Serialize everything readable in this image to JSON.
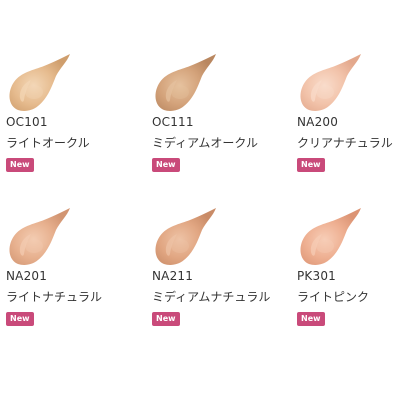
{
  "colors": {
    "badge_bg": "#c94a7a",
    "text": "#333333"
  },
  "badge_label": "New",
  "products": [
    {
      "code": "OC101",
      "name": "ライトオークル",
      "swatch_color": "#e6bb8e",
      "swatch_highlight": "#f3d7b7",
      "swatch_shadow": "#cf9e6d",
      "icon": "foundation-drop-icon"
    },
    {
      "code": "OC111",
      "name": "ミディアムオークル",
      "swatch_color": "#d4a37b",
      "swatch_highlight": "#e6c29f",
      "swatch_shadow": "#b98760",
      "icon": "foundation-drop-icon"
    },
    {
      "code": "NA200",
      "name": "クリアナチュラル",
      "swatch_color": "#f2c3aa",
      "swatch_highlight": "#f9dccb",
      "swatch_shadow": "#e3a88c",
      "icon": "foundation-drop-icon"
    },
    {
      "code": "NA201",
      "name": "ライトナチュラル",
      "swatch_color": "#e7b08e",
      "swatch_highlight": "#f3ccb2",
      "swatch_shadow": "#d29572",
      "icon": "foundation-drop-icon"
    },
    {
      "code": "NA211",
      "name": "ミディアムナチュラル",
      "swatch_color": "#e1a682",
      "swatch_highlight": "#eec3a6",
      "swatch_shadow": "#c98b67",
      "icon": "foundation-drop-icon"
    },
    {
      "code": "PK301",
      "name": "ライトピンク",
      "swatch_color": "#eeaf91",
      "swatch_highlight": "#f7cdb7",
      "swatch_shadow": "#dc9474",
      "icon": "foundation-drop-icon"
    }
  ]
}
